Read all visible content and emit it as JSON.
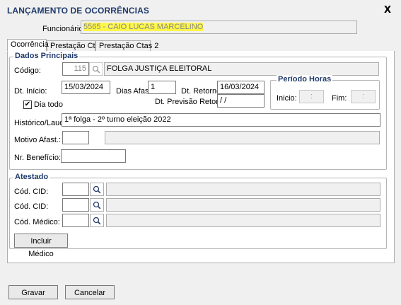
{
  "window": {
    "title": "LANÇAMENTO DE OCORRÊNCIAS",
    "close_label": "X"
  },
  "header": {
    "funcionario_label": "Funcionário:",
    "funcionario_value": "5565 - CAIO LUCAS MARCELINO"
  },
  "tabs": [
    {
      "label": "Ocorrência",
      "active": true
    },
    {
      "label": "Prestação Ctas",
      "active": false
    },
    {
      "label": "Prestação Ctas 2",
      "active": false
    }
  ],
  "dados_principais": {
    "title": "Dados Principais",
    "codigo_label": "Código:",
    "codigo_value": "115",
    "codigo_desc": "FOLGA JUSTIÇA ELEITORAL",
    "dt_inicio_label": "Dt. Início:",
    "dt_inicio_value": "15/03/2024",
    "dias_afast_label": "Dias Afast.",
    "dias_afast_value": "1",
    "dt_retorno_label": "Dt. Retorno:",
    "dt_retorno_value": "16/03/2024",
    "dia_todo_label": "Dia todo",
    "dia_todo_checked": true,
    "dt_previsao_label": "Dt. Previsão Retorno:",
    "dt_previsao_value": " / /",
    "historico_label": "Histórico/Laudo:",
    "historico_value": "1ª folga - 2º turno eleição 2022",
    "motivo_label": "Motivo Afast.:",
    "motivo_value": "",
    "motivo_desc": "",
    "beneficio_label": "Nr. Benefício:",
    "beneficio_value": ""
  },
  "periodo_horas": {
    "title": "Período Horas",
    "inicio_label": "Inicio:",
    "inicio_value": ":",
    "fim_label": "Fim:",
    "fim_value": ":"
  },
  "atestado": {
    "title": "Atestado",
    "cid1_label": "Cód. CID:",
    "cid1_value": "",
    "cid1_desc": "",
    "cid2_label": "Cód. CID:",
    "cid2_value": "",
    "cid2_desc": "",
    "medico_label": "Cód. Médico:",
    "medico_value": "",
    "medico_desc": "",
    "incluir_medico_label": "Incluir Médico"
  },
  "footer": {
    "gravar_label": "Gravar",
    "cancelar_label": "Cancelar"
  }
}
